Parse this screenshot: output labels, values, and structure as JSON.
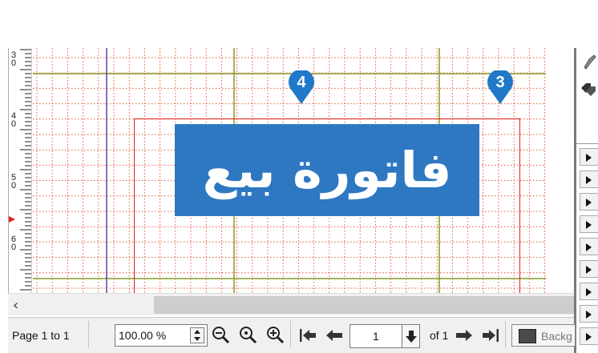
{
  "ruler": {
    "labels": [
      {
        "top": "3",
        "bottom": "0"
      },
      {
        "top": "4",
        "bottom": "0"
      },
      {
        "top": "5",
        "bottom": "0"
      },
      {
        "top": "6",
        "bottom": "0"
      }
    ]
  },
  "canvas": {
    "title_text": "فاتورة بيع",
    "title_bg_color": "#2e78c2",
    "frame_color": "#e02020",
    "grid_color": "#e8553a",
    "marker_color": "#1f78c8",
    "markers": [
      {
        "number": "4"
      },
      {
        "number": "3"
      }
    ]
  },
  "scrollbar": {
    "left_arrow": "‹"
  },
  "statusbar": {
    "page_text": "Page 1 to 1",
    "zoom_value": "100.00 %",
    "page_number": "1",
    "of_text": "of 1",
    "background_label": "Backg"
  },
  "right_panel": {
    "icons": [
      "brush-icon",
      "tags-icon"
    ],
    "button_count": 9
  }
}
